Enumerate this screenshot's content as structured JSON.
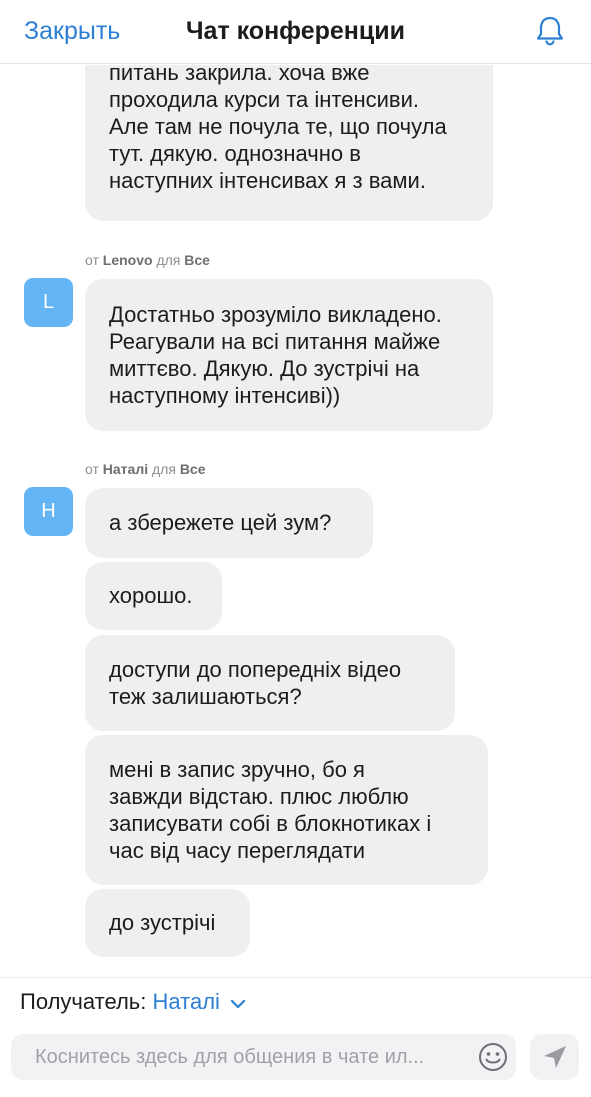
{
  "header": {
    "close_label": "Закрыть",
    "title": "Чат конференции"
  },
  "messages": [
    {
      "sender": null,
      "avatar": null,
      "bubbles": [
        "питань закрила. хоча вже\nпроходила курси та інтенсиви.\nАле там не почула те, що почула\nтут. дякую. однозначно в\nнаступних інтенсивах я з вами."
      ]
    },
    {
      "prefix": "от",
      "sender": "Lenovo",
      "to_prefix": "для",
      "recipient": "Все",
      "avatar": "L",
      "bubbles": [
        "Достатньо зрозуміло викладено.\nРеагували на всі питання майже\nмиттєво. Дякую. До зустрічі на\nнаступному інтенсиві))"
      ]
    },
    {
      "prefix": "от",
      "sender": "Наталі",
      "to_prefix": "для",
      "recipient": "Все",
      "avatar": "Н",
      "bubbles": [
        "а збережете цей зум?",
        "хорошо.",
        "доступи до попередніх відео\nтеж залишаються?",
        "мені в запис зручно, бо я\nзавжди відстаю. плюс люблю\nзаписувати собі в блокнотиках і\nчас від часу переглядати",
        "до зустрічі"
      ]
    }
  ],
  "footer": {
    "recipient_label": "Получатель:",
    "recipient_value": "Наталі",
    "input_placeholder": "Коснитесь здесь для общения в чате ил..."
  },
  "colors": {
    "accent": "#2d7fd4",
    "avatar_bg": "#64b5f6",
    "bubble_bg": "#efeff1"
  }
}
